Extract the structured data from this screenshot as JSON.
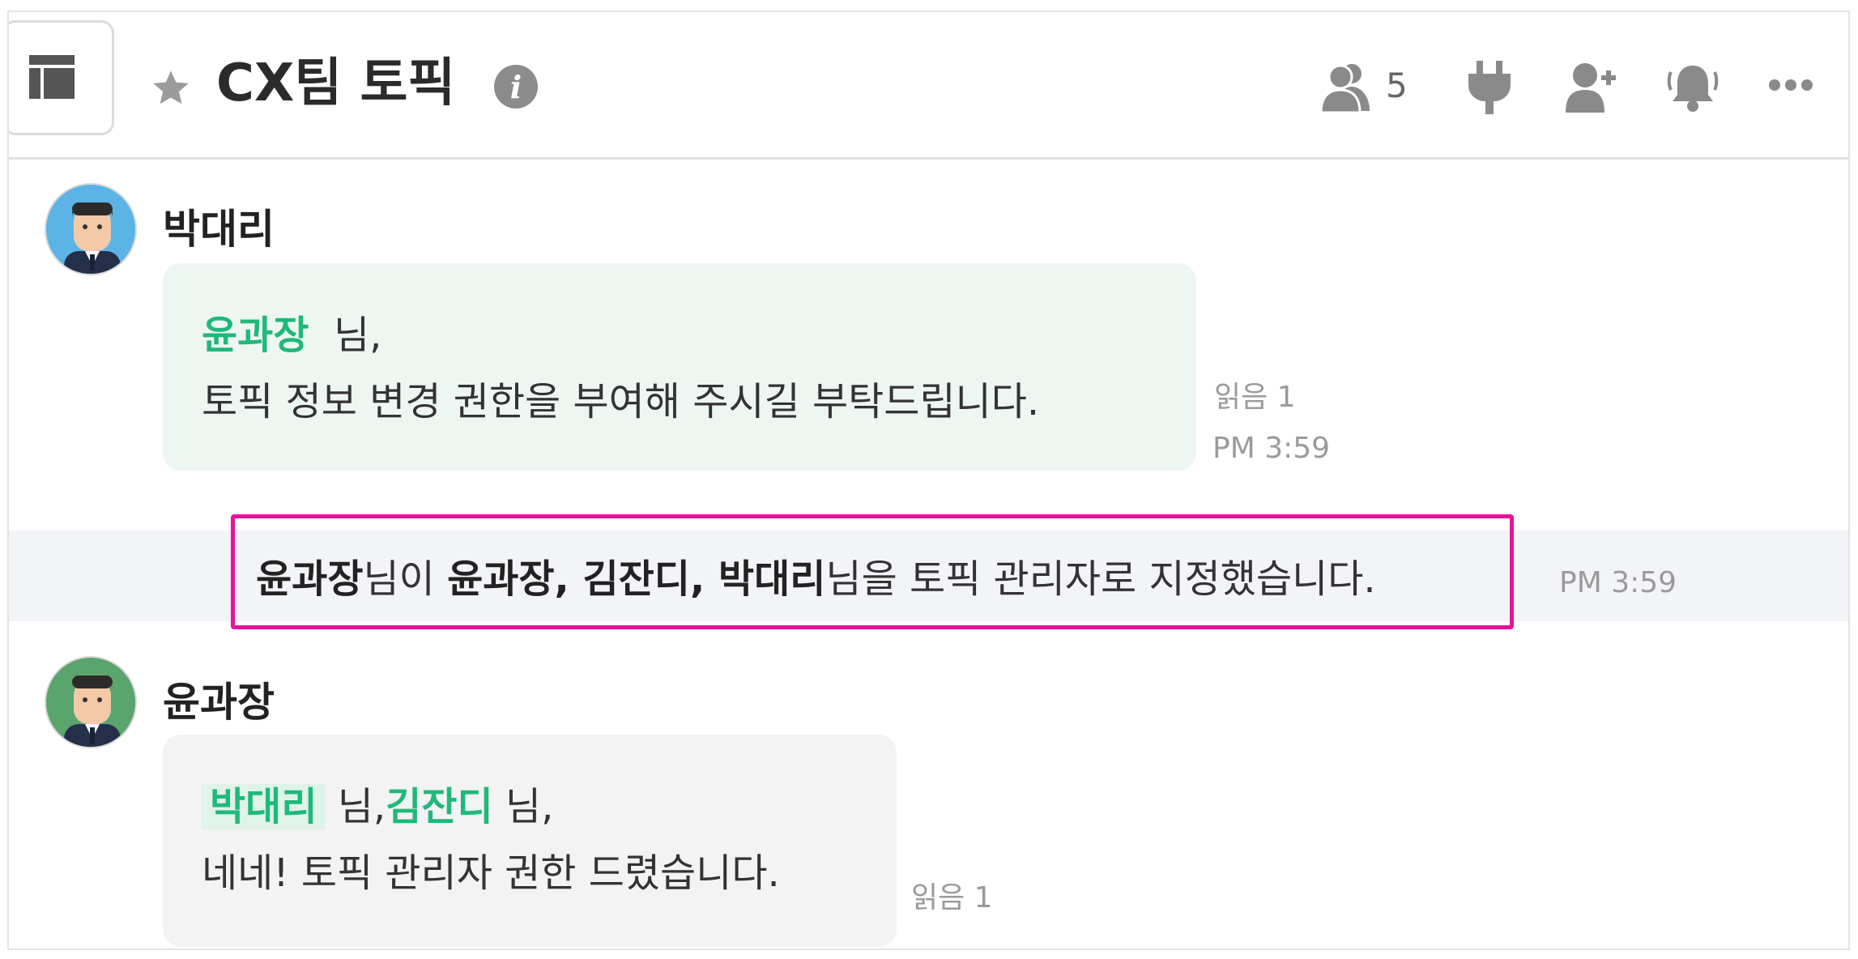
{
  "header": {
    "title": "CX팀 토픽",
    "member_count": "5",
    "icons": [
      "panel-toggle-icon",
      "star-icon",
      "info-icon",
      "members-icon",
      "plug-icon",
      "add-member-icon",
      "notification-bell-icon",
      "more-icon"
    ]
  },
  "messages": [
    {
      "author": "박대리",
      "avatar_color": "#5bb4e5",
      "mention": "윤과장",
      "mention_suffix": "님,",
      "line2": "토픽 정보 변경 권한을 부여해 주시길 부탁드립니다.",
      "read": "읽음 1",
      "time": "PM 3:59"
    },
    {
      "author": "윤과장",
      "avatar_color": "#5aa46d",
      "mention1": "박대리",
      "mention1_suffix": "님,",
      "mention2": "김잔디",
      "mention2_suffix": "님,",
      "line2": "네네! 토픽 관리자 권한 드렸습니다.",
      "read": "읽음 1"
    }
  ],
  "system": {
    "actor": "윤과장",
    "text1": "님이 ",
    "targets": "윤과장, 김잔디, 박대리",
    "text2": "님을 토픽 관리자로 지정했습니다.",
    "time": "PM 3:59"
  },
  "colors": {
    "mention": "#1fb97a",
    "highlight_box": "#e8139a",
    "bubble_green": "#eef6f2",
    "bubble_grey": "#f3f3f3"
  }
}
